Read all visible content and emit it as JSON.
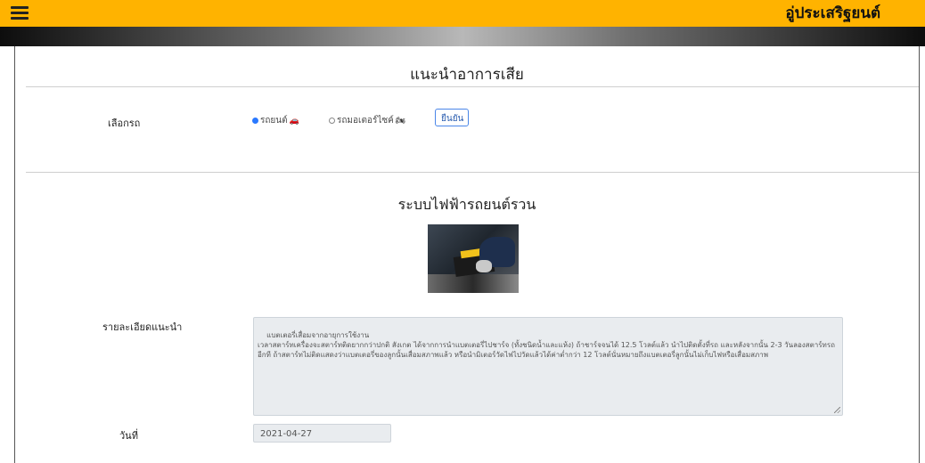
{
  "header": {
    "brand": "อู่ประเสริฐยนต์",
    "accent_color": "#ffb300"
  },
  "page": {
    "title": "แนะนำอาการเสีย"
  },
  "vehicle_select": {
    "label": "เลือกรถ",
    "options": [
      {
        "label": "รถยนต์",
        "icon": "car-icon",
        "checked": true
      },
      {
        "label": "รถมอเตอร์ไซค์",
        "icon": "motorcycle-icon",
        "checked": false
      }
    ],
    "confirm_label": "ยืนยัน"
  },
  "result": {
    "section_title": "ระบบไฟฟ้ารถยนต์รวน",
    "image_icon": "car-battery-photo",
    "details_label": "รายละเอียดแนะนำ",
    "details_text": "แบตเตอรี่เสื่อมจากอายุการใช้งาน\nเวลาสตาร์ทเครื่องจะสตาร์ทติดยากกว่าปกติ สังเกต ได้จากการนำแบตเตอรี่ไปชาร์จ (ทั้งชนิดน้ำและแห้ง) ถ้าชาร์จจนได้ 12.5 โวลต์แล้ว นำไปติดตั้งที่รถ และหลังจากนั้น 2-3 วันลองสตาร์ทรถอีกที ถ้าสตาร์ทไม่ติดแสดงว่าแบตเตอรี่ของลูกนั้นเสื่อมสภาพแล้ว หรือนำมิเตอร์วัดไฟไปวัดแล้วได้ค่าต่ำกว่า 12 โวลต์นั่นหมายถึงแบตเตอรี่ลูกนั้นไม่เก็บไฟหรือเสื่อมสภาพ",
    "date_label": "วันที่",
    "date_value": "2021-04-27"
  }
}
